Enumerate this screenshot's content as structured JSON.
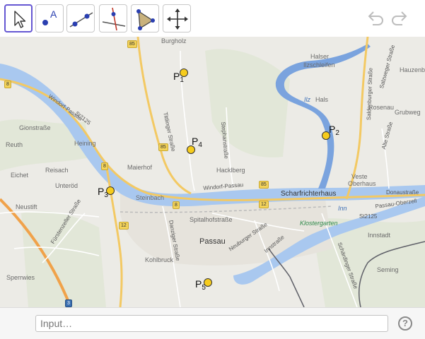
{
  "toolbar": {
    "tools": [
      {
        "name": "move-tool",
        "icon": "arrow-cursor-icon",
        "active": true
      },
      {
        "name": "point-tool",
        "icon": "point-A-icon",
        "glyph": "A"
      },
      {
        "name": "line-tool",
        "icon": "line-through-points-icon"
      },
      {
        "name": "perpendicular-line-tool",
        "icon": "perpendicular-line-icon"
      },
      {
        "name": "polygon-tool",
        "icon": "polygon-icon"
      },
      {
        "name": "move-graphics-view-tool",
        "icon": "four-arrows-icon"
      }
    ],
    "undo_icon": "undo-icon",
    "redo_icon": "redo-icon",
    "accent_color": "#6557d2"
  },
  "map": {
    "place_labels": {
      "burgholz": "Burgholz",
      "halser_ilzschleifen_1": "Halser",
      "halser_ilzschleifen_2": "Ilzschleifen",
      "hals": "Hals",
      "rosenau": "Rosenau",
      "grubweg": "Grubweg",
      "gionstrasse": "Gionstraße",
      "reuth": "Reuth",
      "heining": "Heining",
      "reisach": "Reisach",
      "eichet": "Eichet",
      "maierhof": "Maierhof",
      "hacklberg": "Hacklberg",
      "veste_oberhaus_1": "Veste",
      "veste_oberhaus_2": "Oberhaus",
      "scharfrichterhaus": "Scharfrichterhaus",
      "unterod": "Unteröd",
      "neustift": "Neustift",
      "steinbach": "Steinbach",
      "spitalhofstrasse": "Spitalhofstraße",
      "passau": "Passau",
      "klostergarten": "Klostergarten",
      "kohlbruck": "Kohlbruck",
      "sperrwies": "Sperrwies",
      "innstadt": "Innstadt",
      "seming": "Seming",
      "ilz": "Ilz",
      "inn": "Inn",
      "hauzenb": "Hauzenb",
      "donaustrasse": "Donaustraße"
    },
    "street_labels": {
      "windorf_passau": "Windorf-Passau",
      "st2125": "St2125",
      "tittlinger_strasse": "Tittlinger Straße",
      "stephanstrasse": "Stephanstraße",
      "saldenburger_strasse": "Saldenburger Straße",
      "alte_strasse": "Alte Straße",
      "salzweger_strasse": "Salzweger Straße",
      "furstenzeller_strasse": "Fürstenzeller Straße",
      "danziger_strasse": "Danziger Straße",
      "neuburger_strasse": "Neuburger Straße",
      "innstrasse": "Innstraße",
      "schardinger_strasse": "Schärdinger Straße",
      "passau_oberzell": "Passau-Oberzell",
      "st2125_east": "St2125",
      "windorf_passau_south": "Windorf-Passau"
    },
    "road_shields": {
      "b85_top": "85",
      "b85_mid": "85",
      "b85_river": "85",
      "r8_left": "8",
      "r8_mid": "8",
      "r8_west": "8",
      "r12_a": "12",
      "r12_b": "12",
      "a3": "3"
    },
    "colors": {
      "water": "#a9c8ef",
      "water_dark": "#7aa3de",
      "road_major": "#f3c963",
      "road_minor": "#ffffff",
      "motorway": "#f0a24a",
      "border": "#5f6068",
      "point_fill": "#f6cc1d"
    },
    "points": [
      {
        "id": "p1",
        "letter": "P",
        "sub": "1"
      },
      {
        "id": "p2",
        "letter": "P",
        "sub": "2"
      },
      {
        "id": "p3",
        "letter": "P",
        "sub": "3"
      },
      {
        "id": "p4",
        "letter": "P",
        "sub": "4"
      },
      {
        "id": "p5",
        "letter": "P",
        "sub": "5"
      }
    ]
  },
  "input_bar": {
    "placeholder": "Input…",
    "help_icon": "help-icon",
    "help_glyph": "?"
  }
}
